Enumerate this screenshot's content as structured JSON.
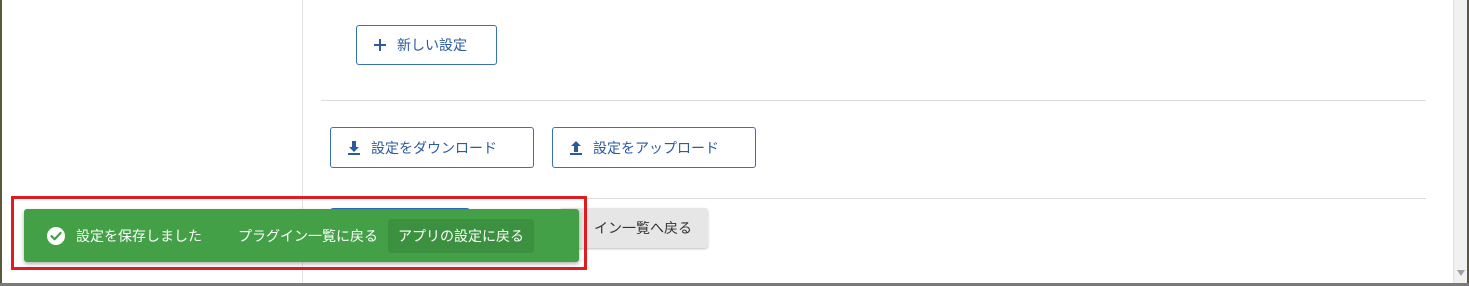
{
  "settings": {
    "new_setting_label": "新しい設定",
    "download_label": "設定をダウンロード",
    "upload_label": "設定をアップロード",
    "back_to_plugin_list_label": "イン一覧へ戻る"
  },
  "snackbar": {
    "message": "設定を保存しました",
    "action_plugins": "プラグイン一覧に戻る",
    "action_app_settings": "アプリの設定に戻る"
  },
  "colors": {
    "accent_blue": "#2a5aa0",
    "snackbar_green": "#43a047",
    "highlight_red": "#e11b22"
  }
}
